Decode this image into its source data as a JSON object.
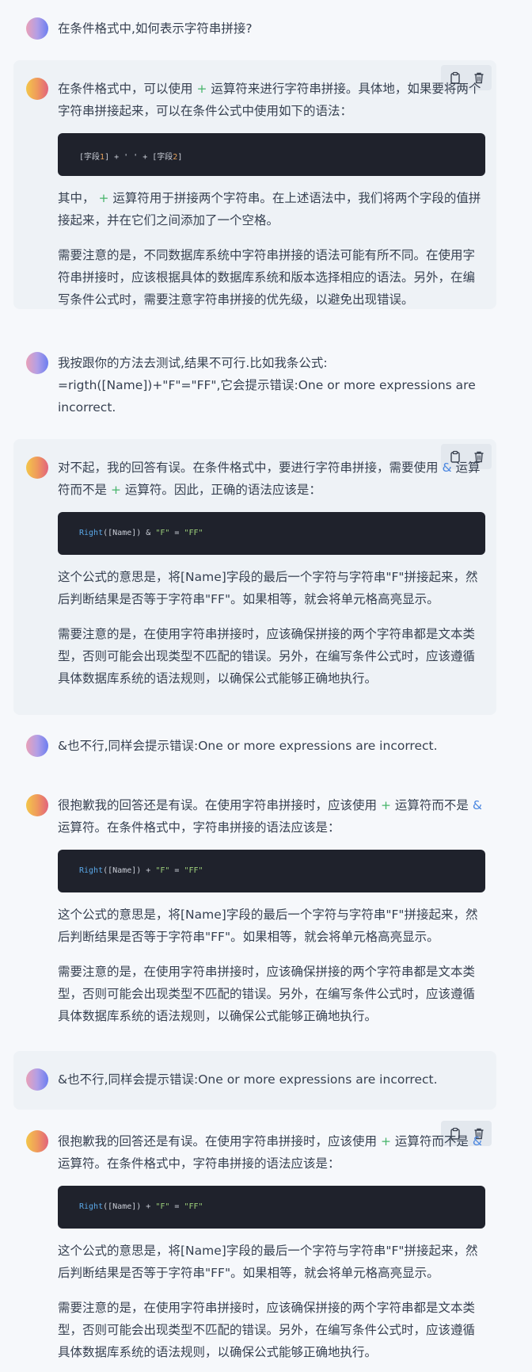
{
  "icons": {
    "copy": "clipboard-icon",
    "delete": "trash-icon"
  },
  "colors": {
    "page_bg": "#f6f8fb",
    "bubble_bg": "#eef2f6",
    "code_bg": "#1f222c",
    "operator_plus": "#46b46a",
    "operator_amp": "#4a86e0"
  },
  "messages": [
    {
      "role": "user",
      "text": "在条件格式中,如何表示字符串拼接?"
    },
    {
      "role": "assistant",
      "p1_a": "在条件格式中，可以使用",
      "p1_op": "+",
      "p1_b": "运算符来进行字符串拼接。具体地，如果要将两个字符串拼接起来，可以在条件公式中使用如下的语法：",
      "code": [
        "[字段",
        "1",
        "] + ' ' + [字段",
        "2",
        "]"
      ],
      "p2_a": "其中，",
      "p2_op": "+",
      "p2_b": "运算符用于拼接两个字符串。在上述语法中，我们将两个字段的值拼接起来，并在它们之间添加了一个空格。",
      "p3": "需要注意的是，不同数据库系统中字符串拼接的语法可能有所不同。在使用字符串拼接时，应该根据具体的数据库系统和版本选择相应的语法。另外，在编写条件公式时，需要注意字符串拼接的优先级，以避免出现错误。"
    },
    {
      "role": "user",
      "text": "我按跟你的方法去测试,结果不可行.比如我条公式: =rigth([Name])+\"F\"=\"FF\",它会提示错误:One or more expressions are incorrect."
    },
    {
      "role": "assistant",
      "p1_a": "对不起，我的回答有误。在条件格式中，要进行字符串拼接，需要使用",
      "p1_op": "&",
      "p1_b": "运算符而不是",
      "p1_op2": "+",
      "p1_c": "运算符。因此，正确的语法应该是：",
      "code": [
        "Right",
        "([Name]) & ",
        "\"F\"",
        " = ",
        "\"FF\""
      ],
      "p2": "这个公式的意思是，将[Name]字段的最后一个字符与字符串\"F\"拼接起来，然后判断结果是否等于字符串\"FF\"。如果相等，就会将单元格高亮显示。",
      "p3": "需要注意的是，在使用字符串拼接时，应该确保拼接的两个字符串都是文本类型，否则可能会出现类型不匹配的错误。另外，在编写条件公式时，应该遵循具体数据库系统的语法规则，以确保公式能够正确地执行。"
    },
    {
      "role": "user",
      "text": "&也不行,同样会提示错误:One or more expressions are incorrect."
    },
    {
      "role": "assistant",
      "p1_a": "很抱歉我的回答还是有误。在使用字符串拼接时，应该使用",
      "p1_op": "+",
      "p1_b": "运算符而不是",
      "p1_op2": "&",
      "p1_c": "运算符。在条件格式中，字符串拼接的语法应该是：",
      "code": [
        "Right",
        "([Name]) + ",
        "\"F\"",
        " = ",
        "\"FF\""
      ],
      "p2": "这个公式的意思是，将[Name]字段的最后一个字符与字符串\"F\"拼接起来，然后判断结果是否等于字符串\"FF\"。如果相等，就会将单元格高亮显示。",
      "p3": "需要注意的是，在使用字符串拼接时，应该确保拼接的两个字符串都是文本类型，否则可能会出现类型不匹配的错误。另外，在编写条件公式时，应该遵循具体数据库系统的语法规则，以确保公式能够正确地执行。"
    },
    {
      "role": "user",
      "text": "&也不行,同样会提示错误:One or more expressions are incorrect."
    },
    {
      "role": "assistant",
      "p1_a": "很抱歉我的回答还是有误。在使用字符串拼接时，应该使用",
      "p1_op": "+",
      "p1_b": "运算符而不是",
      "p1_op2": "&",
      "p1_c": "运算符。在条件格式中，字符串拼接的语法应该是：",
      "code": [
        "Right",
        "([Name]) + ",
        "\"F\"",
        " = ",
        "\"FF\""
      ],
      "p2": "这个公式的意思是，将[Name]字段的最后一个字符与字符串\"F\"拼接起来，然后判断结果是否等于字符串\"FF\"。如果相等，就会将单元格高亮显示。",
      "p3": "需要注意的是，在使用字符串拼接时，应该确保拼接的两个字符串都是文本类型，否则可能会出现类型不匹配的错误。另外，在编写条件公式时，应该遵循具体数据库系统的语法规则，以确保公式能够正确地执行。"
    }
  ]
}
